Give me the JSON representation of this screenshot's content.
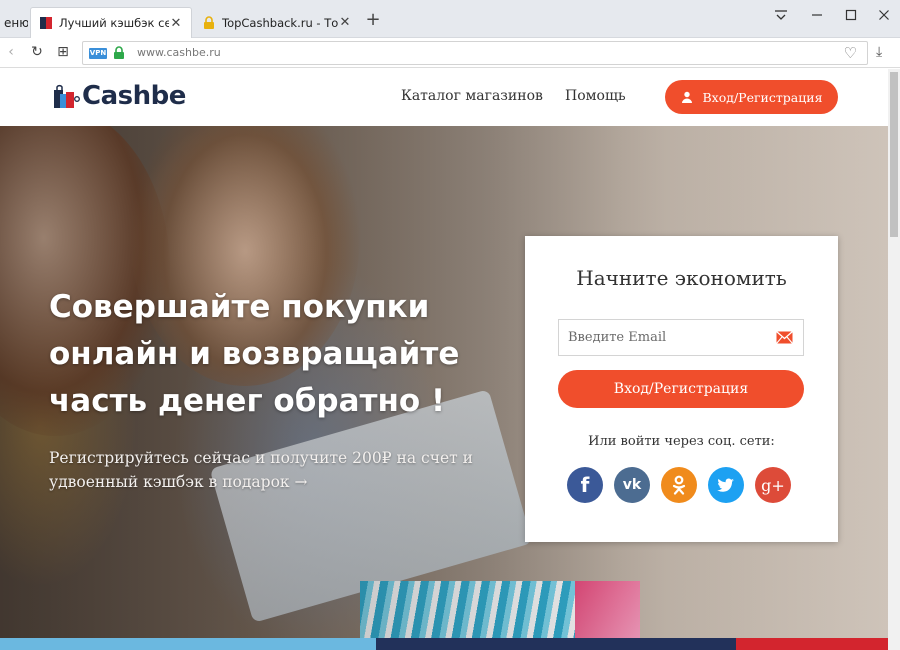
{
  "browser": {
    "menu_tab_label": "еню",
    "tabs": [
      {
        "title": "Лучший кэшбэк сервис С",
        "close": "✕"
      },
      {
        "title": "TopCashback.ru - Топ луч",
        "close": "✕"
      }
    ],
    "new_tab": "+",
    "window_controls": {
      "menu": "⩸",
      "minimize": "—",
      "maximize": "☐",
      "close": "✕"
    },
    "nav": {
      "back": "‹",
      "reload": "↻",
      "apps": "⊞"
    },
    "vpn_label": "VPN",
    "url": "www.cashbe.ru",
    "bookmark_icon": "♡",
    "download_icon": "⤓"
  },
  "site": {
    "logo_text": "Cashbe",
    "nav": {
      "catalog": "Каталог магазинов",
      "help": "Помощь",
      "login_button": "Вход/Регистрация"
    }
  },
  "hero": {
    "title": "Совершайте покупки онлайн и возвращайте часть денег обратно !",
    "subtitle": "Регистрируйтесь сейчас и получите 200₽ на счет и удвоенный кэшбэк в подарок →"
  },
  "signup": {
    "title": "Начните экономить",
    "email_placeholder": "Введите Email",
    "button": "Вход/Регистрация",
    "social_label": "Или войти через соц. сети:",
    "social": [
      {
        "name": "facebook",
        "glyph": "f",
        "color": "#3b5998"
      },
      {
        "name": "vk",
        "glyph": "vk",
        "color": "#4c6c91"
      },
      {
        "name": "odnoklassniki",
        "glyph": "ok",
        "color": "#f08b1c"
      },
      {
        "name": "twitter",
        "glyph": "t",
        "color": "#1da1f2"
      },
      {
        "name": "google-plus",
        "glyph": "g+",
        "color": "#dd4b39"
      }
    ]
  },
  "colors": {
    "accent": "#f04e2c",
    "logo_dark": "#1f2d4a",
    "stripe_blue": "#6bb8e0",
    "stripe_navy": "#22315a",
    "stripe_red": "#d3252e"
  }
}
